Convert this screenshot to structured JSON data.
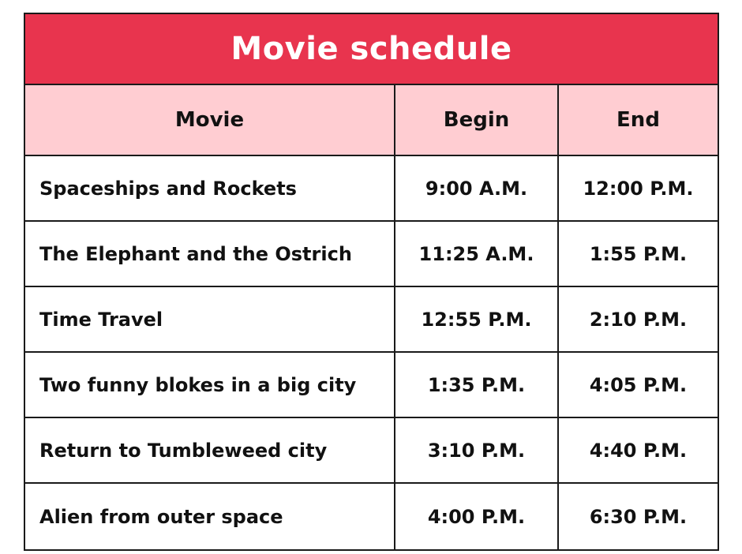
{
  "title": "Movie schedule",
  "colors": {
    "title_background": "#e8344e",
    "header_background": "#ffcdd2",
    "title_text": "#ffffff",
    "border": "#1a1a1a"
  },
  "table": {
    "headers": [
      "Movie",
      "Begin",
      "End"
    ],
    "rows": [
      {
        "movie": "Spaceships and Rockets",
        "begin": "9:00 A.M.",
        "end": "12:00 P.M."
      },
      {
        "movie": "The Elephant and the Ostrich",
        "begin": "11:25 A.M.",
        "end": "1:55 P.M."
      },
      {
        "movie": "Time Travel",
        "begin": "12:55 P.M.",
        "end": "2:10 P.M."
      },
      {
        "movie": "Two funny blokes in a big city",
        "begin": "1:35 P.M.",
        "end": "4:05 P.M."
      },
      {
        "movie": "Return to Tumbleweed city",
        "begin": "3:10 P.M.",
        "end": "4:40 P.M."
      },
      {
        "movie": "Alien from outer space",
        "begin": "4:00 P.M.",
        "end": "6:30 P.M."
      }
    ]
  }
}
